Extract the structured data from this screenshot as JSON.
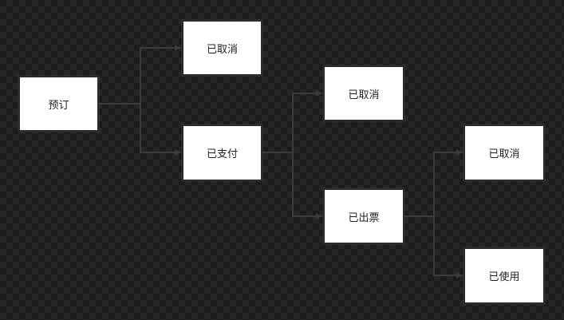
{
  "nodes": {
    "booking": "预订",
    "cancel_1": "已取消",
    "paid": "已支付",
    "cancel_2": "已取消",
    "ticketed": "已出票",
    "cancel_3": "已取消",
    "used": "已使用"
  },
  "edges": [
    {
      "from": "booking",
      "to": "cancel_1"
    },
    {
      "from": "booking",
      "to": "paid"
    },
    {
      "from": "paid",
      "to": "cancel_2"
    },
    {
      "from": "paid",
      "to": "ticketed"
    },
    {
      "from": "ticketed",
      "to": "cancel_3"
    },
    {
      "from": "ticketed",
      "to": "used"
    }
  ],
  "colors": {
    "connector": "#3c3c3c",
    "node_fill": "#ffffff",
    "node_text": "#222222"
  }
}
